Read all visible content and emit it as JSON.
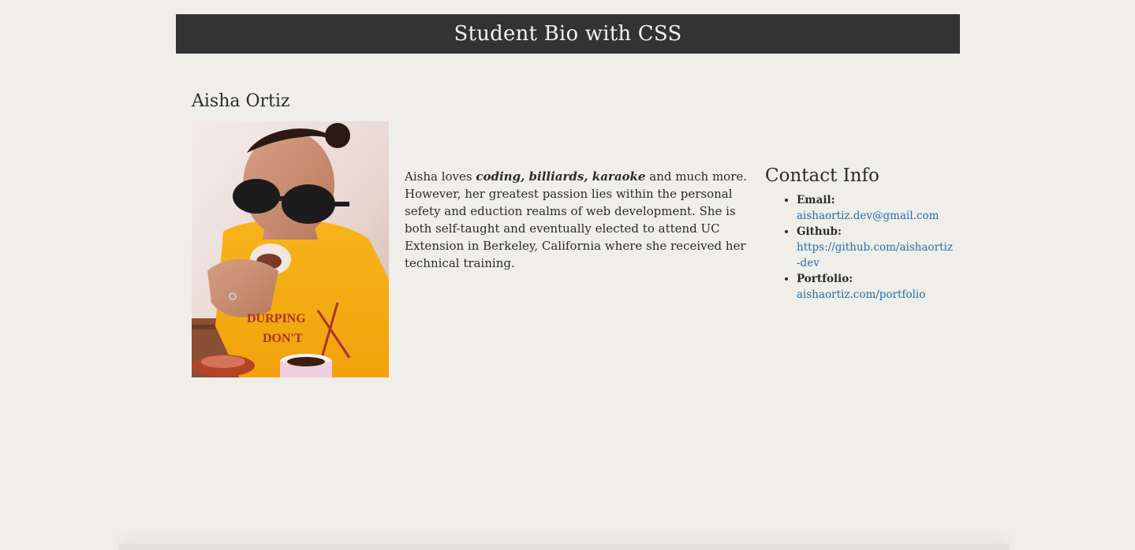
{
  "header": {
    "title": "Student Bio with CSS"
  },
  "profile": {
    "name": "Aisha Ortiz",
    "photo_alt": "Aisha Ortiz",
    "bio": {
      "intro": "Aisha loves ",
      "hobbies": "coding, billiards, karaoke",
      "rest": " and much more. However, her greatest passion lies within the personal sefety and eduction realms of web development. She is both self-taught and eventually elected to attend UC Extension in Berkeley, California where she received her technical training."
    }
  },
  "contact": {
    "title": "Contact Info",
    "items": [
      {
        "label": "Email:",
        "value": "aishaortiz.dev@gmail.com"
      },
      {
        "label": "Github:",
        "value": "https://github.com/aishaortiz-dev"
      },
      {
        "label": "Portfolio:",
        "value": "aishaortiz.com/portfolio"
      }
    ]
  },
  "colors": {
    "background": "#efeee8",
    "header_bg": "#333333",
    "header_text": "#f2f2f2",
    "link": "#1f6fb0"
  }
}
